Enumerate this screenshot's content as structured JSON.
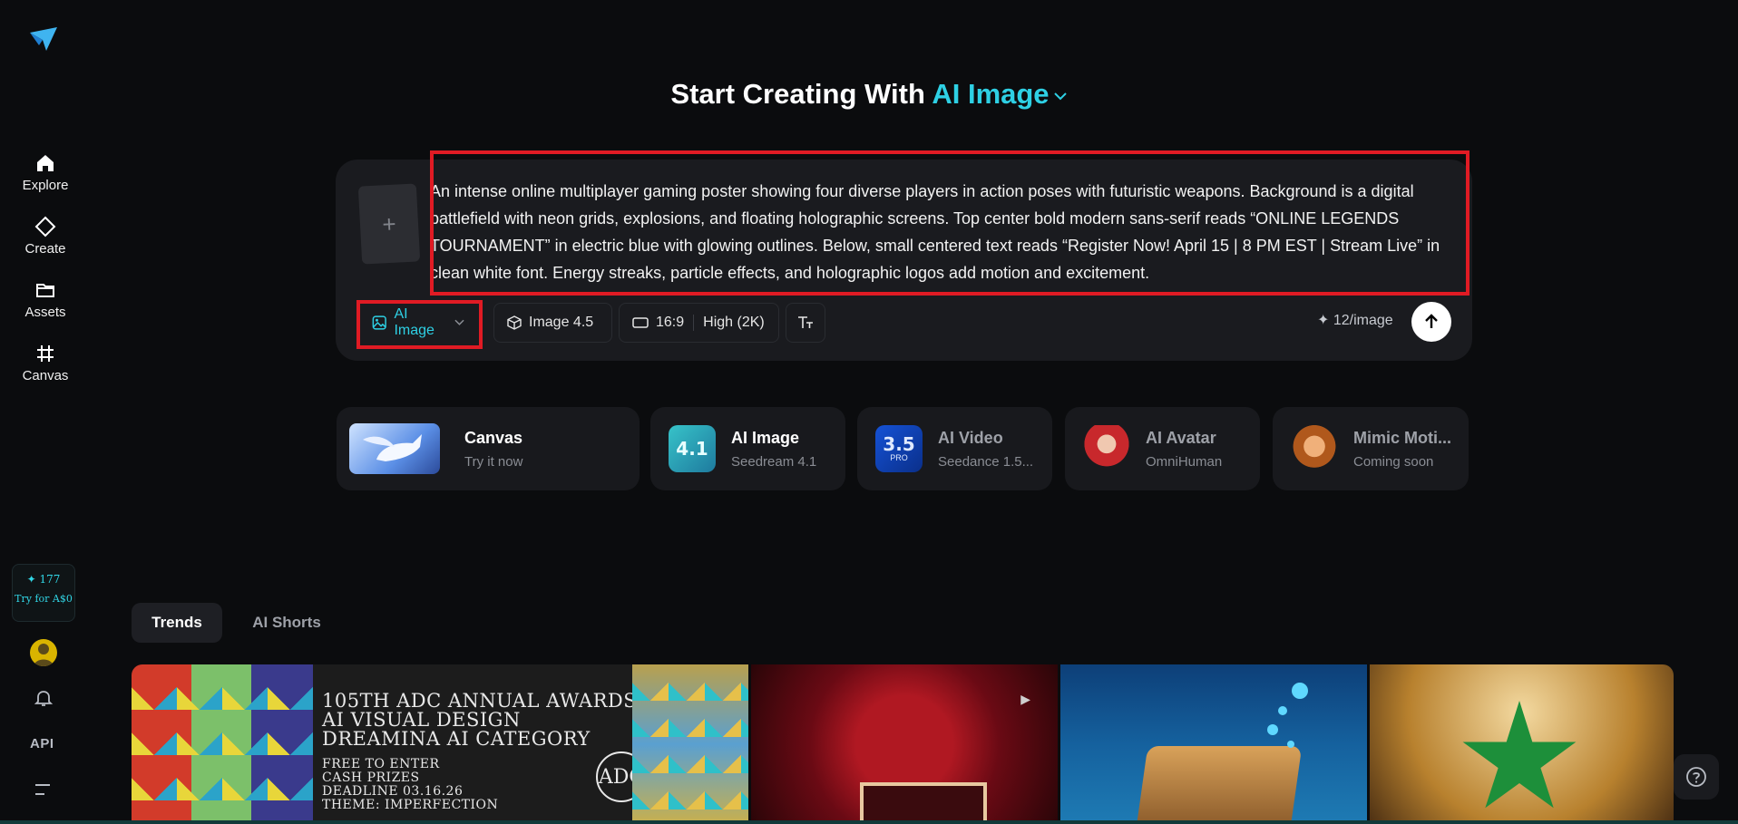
{
  "sidebar": {
    "items": [
      {
        "label": "Explore",
        "icon": "home-icon"
      },
      {
        "label": "Create",
        "icon": "diamond-icon"
      },
      {
        "label": "Assets",
        "icon": "folder-icon"
      },
      {
        "label": "Canvas",
        "icon": "frame-icon"
      }
    ],
    "credits": {
      "count": "✦ 177",
      "cta": "Try for A$0"
    },
    "api_label": "API"
  },
  "heading": {
    "prefix": "Start Creating With",
    "mode": "AI Image"
  },
  "composer": {
    "add_reference": "+",
    "prompt": "An intense online multiplayer gaming poster showing four diverse players in action poses with futuristic weapons. Background is a digital battlefield with neon grids, explosions, and floating holographic screens. Top center bold modern sans-serif reads “ONLINE LEGENDS TOURNAMENT” in electric blue with glowing outlines. Below, small centered text reads “Register Now! April 15 | 8 PM EST | Stream Live” in clean white font. Energy streaks, particle effects, and holographic logos add motion and excitement.",
    "mode_label": "AI Image",
    "model_label": "Image 4.5",
    "ratio_label": "16:9",
    "quality_label": "High (2K)",
    "cost_label": "12/image"
  },
  "features": [
    {
      "title": "Canvas",
      "subtitle": "Try it now"
    },
    {
      "title": "AI Image",
      "subtitle": "Seedream 4.1",
      "badge": "4.1"
    },
    {
      "title": "AI Video",
      "subtitle": "Seedance 1.5...",
      "badge": "3.5",
      "badge_sub": "PRO"
    },
    {
      "title": "AI Avatar",
      "subtitle": "OmniHuman"
    },
    {
      "title": "Mimic Moti...",
      "subtitle": "Coming soon"
    }
  ],
  "tabs": [
    {
      "label": "Trends",
      "active": true
    },
    {
      "label": "AI Shorts",
      "active": false
    }
  ],
  "gallery": {
    "poster_title": [
      "105TH ADC ANNUAL AWARDS",
      "AI VISUAL DESIGN",
      "DREAMINA AI CATEGORY"
    ],
    "poster_details": [
      "FREE TO ENTER",
      "CASH PRIZES",
      "DEADLINE 03.16.26",
      "THEME: IMPERFECTION"
    ],
    "seal": "ADC"
  },
  "colors": {
    "accent": "#2ed0e4",
    "highlight": "#e01b24",
    "background": "#0b0c0e",
    "panel": "#1a1b1f"
  }
}
